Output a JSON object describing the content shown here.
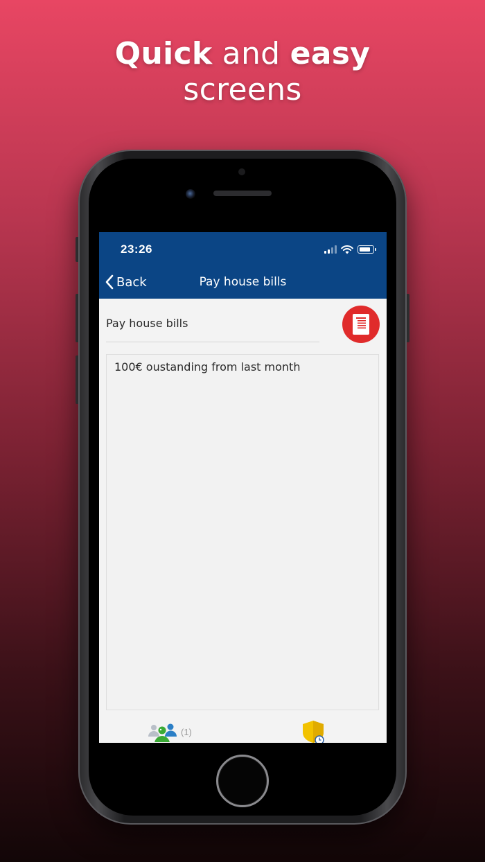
{
  "headline": {
    "line1_bold_a": "Quick",
    "line1_mid": " and ",
    "line1_bold_b": "easy",
    "line2": "screens"
  },
  "status_bar": {
    "time": "23:26"
  },
  "nav": {
    "back_label": "Back",
    "title": "Pay house bills"
  },
  "task": {
    "title": "Pay house bills",
    "notes": "100€ oustanding from last month"
  },
  "tabbar": {
    "people_count": "(1)"
  },
  "colors": {
    "nav_background": "#0b4585",
    "document_button": "#e02b2b",
    "shield": "#f2c200"
  }
}
